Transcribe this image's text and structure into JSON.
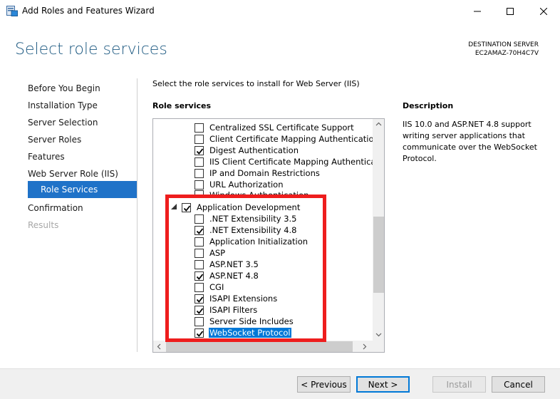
{
  "window": {
    "title": "Add Roles and Features Wizard",
    "controls": [
      "minimize-icon",
      "maximize-icon",
      "close-icon"
    ]
  },
  "header": {
    "page_title": "Select role services",
    "destination_label": "DESTINATION SERVER",
    "destination_name": "EC2AMAZ-70H4C7V"
  },
  "nav": {
    "items": [
      {
        "label": "Before You Begin",
        "state": "normal"
      },
      {
        "label": "Installation Type",
        "state": "normal"
      },
      {
        "label": "Server Selection",
        "state": "normal"
      },
      {
        "label": "Server Roles",
        "state": "normal"
      },
      {
        "label": "Features",
        "state": "normal"
      },
      {
        "label": "Web Server Role (IIS)",
        "state": "normal"
      },
      {
        "label": "Role Services",
        "state": "active"
      },
      {
        "label": "Confirmation",
        "state": "normal"
      },
      {
        "label": "Results",
        "state": "disabled"
      }
    ]
  },
  "content": {
    "instruction": "Select the role services to install for Web Server (IIS)",
    "role_services_heading": "Role services",
    "description_heading": "Description",
    "description_text": "IIS 10.0 and ASP.NET 4.8 support writing server applications that communicate over the WebSocket Protocol."
  },
  "tree": {
    "items": [
      {
        "label": "Centralized SSL Certificate Support",
        "checked": false
      },
      {
        "label": "Client Certificate Mapping Authentication",
        "checked": false
      },
      {
        "label": "Digest Authentication",
        "checked": true
      },
      {
        "label": "IIS Client Certificate Mapping Authenticat",
        "checked": false
      },
      {
        "label": "IP and Domain Restrictions",
        "checked": false
      },
      {
        "label": "URL Authorization",
        "checked": false
      },
      {
        "label": "Windows Authentication",
        "checked": false
      },
      {
        "label": "Application Development",
        "checked": true,
        "expanded": true
      },
      {
        "label": ".NET Extensibility 3.5",
        "checked": false
      },
      {
        "label": ".NET Extensibility 4.8",
        "checked": true
      },
      {
        "label": "Application Initialization",
        "checked": false
      },
      {
        "label": "ASP",
        "checked": false
      },
      {
        "label": "ASP.NET 3.5",
        "checked": false
      },
      {
        "label": "ASP.NET 4.8",
        "checked": true
      },
      {
        "label": "CGI",
        "checked": false
      },
      {
        "label": "ISAPI Extensions",
        "checked": true
      },
      {
        "label": "ISAPI Filters",
        "checked": true
      },
      {
        "label": "Server Side Includes",
        "checked": false
      },
      {
        "label": "WebSocket Protocol",
        "checked": true,
        "selected": true
      }
    ]
  },
  "footer": {
    "previous_label": "< Previous",
    "next_label": "Next >",
    "install_label": "Install",
    "cancel_label": "Cancel"
  },
  "colors": {
    "accent": "#1f72c8",
    "title": "#1e5a82",
    "highlight": "#ee1d1d",
    "selection": "#0078d7"
  }
}
